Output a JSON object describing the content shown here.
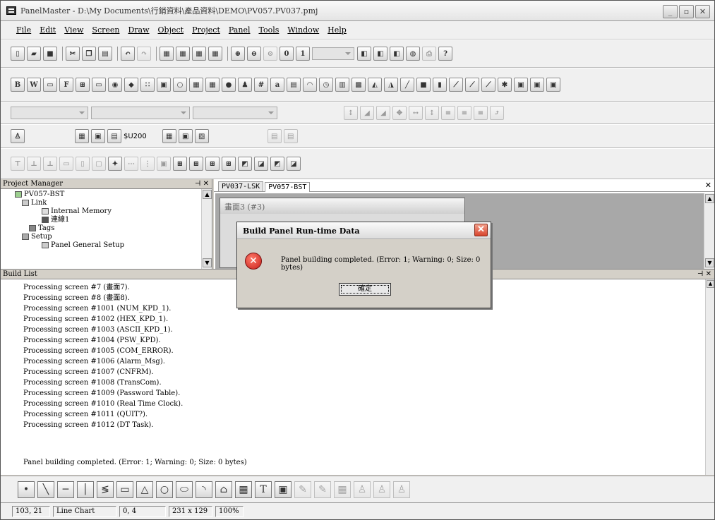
{
  "window": {
    "title": "PanelMaster - D:\\My Documents\\行銷資料\\產品資料\\DEMO\\PV057.PV037.pmj"
  },
  "menu": [
    "File",
    "Edit",
    "View",
    "Screen",
    "Draw",
    "Object",
    "Project",
    "Panel",
    "Tools",
    "Window",
    "Help"
  ],
  "toolbar4": {
    "combo_value": "$U200"
  },
  "project_manager": {
    "title": "Project Manager",
    "tree": [
      "PV057-BST",
      "Link",
      "Internal Memory",
      "連線1",
      "Tags",
      "Setup",
      "Panel General Setup"
    ]
  },
  "editor": {
    "tabs": [
      "PV037-LSK",
      "PV057-BST"
    ],
    "active_tab": "PV057-BST",
    "subwindow_title": "畫面3 (#3)"
  },
  "dialog": {
    "title": "Build Panel Run-time Data",
    "message": "Panel building completed. (Error: 1; Warning: 0; Size: 0 bytes)",
    "ok_label": "確定"
  },
  "build_list": {
    "title": "Build List",
    "lines": [
      "Processing screen #7 (畫面7).",
      "Processing screen #8 (畫面8).",
      "Processing screen #1001 (NUM_KPD_1).",
      "Processing screen #1002 (HEX_KPD_1).",
      "Processing screen #1003 (ASCII_KPD_1).",
      "Processing screen #1004 (PSW_KPD).",
      "Processing screen #1005 (COM_ERROR).",
      "Processing screen #1006 (Alarm_Msg).",
      "Processing screen #1007 (CNFRM).",
      "Processing screen #1008 (TransCom).",
      "Processing screen #1009 (Password Table).",
      "Processing screen #1010 (Real Time Clock).",
      "Processing screen #1011 (QUIT?).",
      "Processing screen #1012 (DT Task)."
    ],
    "final": "Panel building completed. (Error: 1; Warning: 0; Size: 0 bytes)"
  },
  "statusbar": {
    "pos": "103, 21",
    "object": "Line Chart",
    "offset": "0, 4",
    "size": "231 x 129",
    "zoom": "100%"
  }
}
